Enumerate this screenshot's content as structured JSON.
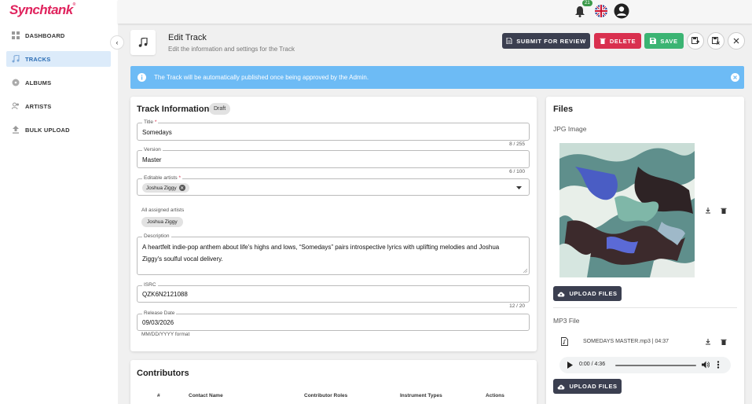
{
  "app": {
    "logo": "Synchtank",
    "logo_mark": "®"
  },
  "sidebar": {
    "items": [
      {
        "label": "DASHBOARD",
        "icon": "dashboard-icon"
      },
      {
        "label": "TRACKS",
        "icon": "music-note-icon",
        "active": true
      },
      {
        "label": "ALBUMS",
        "icon": "album-icon"
      },
      {
        "label": "ARTISTS",
        "icon": "artists-icon"
      },
      {
        "label": "BULK UPLOAD",
        "icon": "upload-icon"
      }
    ]
  },
  "topbar": {
    "notification_count": "21",
    "language_icon": "uk-flag-icon",
    "account_icon": "account-circle-icon"
  },
  "header": {
    "title": "Edit Track",
    "subtitle": "Edit the information and settings for the Track",
    "submit_label": "SUBMIT FOR REVIEW",
    "delete_label": "DELETE",
    "save_label": "SAVE"
  },
  "banner": {
    "text": "The Track will be automatically published once being approved by the Admin."
  },
  "track_info": {
    "title": "Track Information",
    "status": "Draft",
    "fields": {
      "title": {
        "label": "Title",
        "required": "*",
        "value": "Somedays",
        "counter": "8 / 255"
      },
      "version": {
        "label": "Version",
        "value": "Master",
        "counter": "6 / 100"
      },
      "editable_artists": {
        "label": "Editable artists",
        "required": "*",
        "chip": "Joshua Ziggy"
      },
      "assigned_artists": {
        "label": "All assigned artists",
        "chip": "Joshua Ziggy"
      },
      "description": {
        "label": "Description",
        "value": "A heartfelt indie-pop anthem about life's highs and lows, “Somedays” pairs introspective lyrics with uplifting melodies and Joshua Ziggy's soulful vocal delivery."
      },
      "isrc": {
        "label": "ISRC",
        "value": "QZK6N2121088",
        "counter": "12 / 20"
      },
      "release_date": {
        "label": "Release Date",
        "value": "09/03/2026",
        "helper": "MM/DD/YYYY format"
      }
    }
  },
  "contributors": {
    "title": "Contributors",
    "columns": [
      "#",
      "Contact Name",
      "Contributor Roles",
      "Instrument Types",
      "Actions"
    ]
  },
  "files": {
    "title": "Files",
    "jpg_label": "JPG Image",
    "upload_label": "UPLOAD FILES",
    "mp3_label": "MP3 File",
    "mp3_name": "SOMEDAYS MASTER.mp3 | 04:37",
    "audio_time": "0:00 / 4:36"
  },
  "colors": {
    "brand": "#e0245e",
    "dark_button": "#3b3f50",
    "delete": "#d9304f",
    "save": "#3bb473",
    "banner": "#6dbbf5",
    "active_nav": "#dcebfa"
  }
}
